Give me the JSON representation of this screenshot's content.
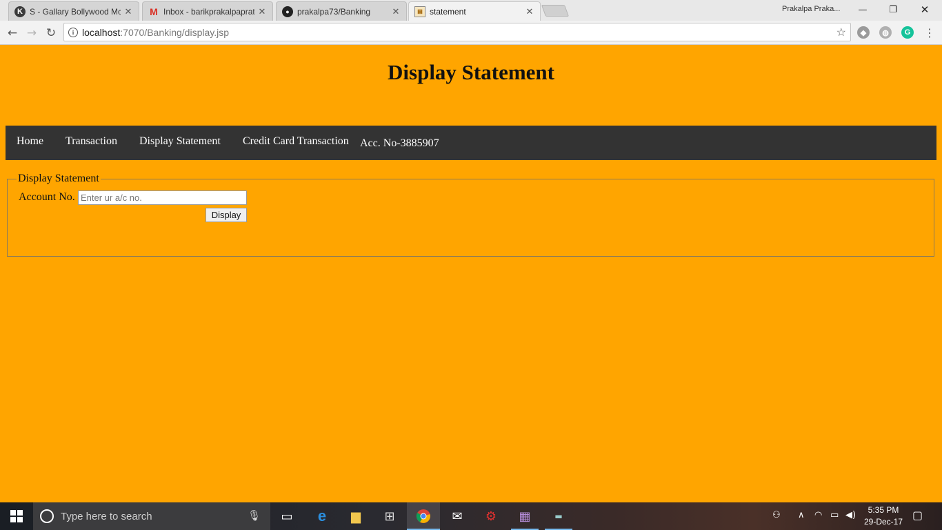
{
  "browser": {
    "tabs": [
      {
        "title": "S - Gallary Bollywood Mc",
        "icon": "k-logo-icon"
      },
      {
        "title": "Inbox - barikprakalpaprat",
        "icon": "gmail-icon"
      },
      {
        "title": "prakalpa73/Banking",
        "icon": "github-icon"
      },
      {
        "title": "statement",
        "icon": "page-favicon-icon"
      }
    ],
    "profile_name": "Prakalpa Praka...",
    "url_host": "localhost",
    "url_path": ":7070/Banking/display.jsp"
  },
  "page": {
    "heading": "Display Statement",
    "nav": {
      "home": "Home",
      "transaction": "Transaction",
      "display_statement": "Display Statement",
      "credit_card": "Credit Card Transaction",
      "account_info": "Acc. No-3885907"
    },
    "form": {
      "legend": "Display Statement",
      "account_label": "Account No.",
      "account_placeholder": "Enter ur a/c no.",
      "account_value": "",
      "submit_label": "Display"
    },
    "colors": {
      "background": "#ffa500",
      "navbar": "#333333"
    }
  },
  "taskbar": {
    "search_placeholder": "Type here to search",
    "time": "5:35 PM",
    "date": "29-Dec-17"
  }
}
